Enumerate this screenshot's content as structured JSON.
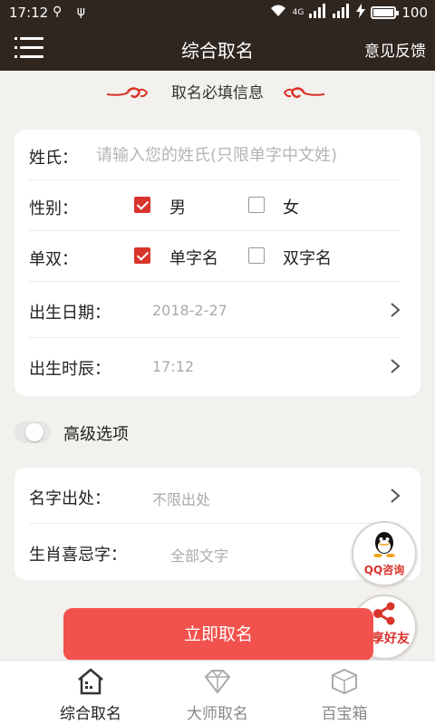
{
  "status_bar": {
    "time": "17:12",
    "battery": "100",
    "battery_level": 1.0,
    "network": "4G"
  },
  "navbar": {
    "title": "综合取名",
    "feedback": "意见反馈"
  },
  "section_title": "取名必填信息",
  "form": {
    "surname": {
      "label": "姓氏：",
      "placeholder": "请输入您的姓氏(只限单字中文姓)"
    },
    "gender": {
      "label": "性别：",
      "options": [
        {
          "label": "男",
          "checked": true
        },
        {
          "label": "女",
          "checked": false
        }
      ]
    },
    "single_double": {
      "label": "单双：",
      "options": [
        {
          "label": "单字名",
          "checked": true
        },
        {
          "label": "双字名",
          "checked": false
        }
      ]
    },
    "birth_date": {
      "label": "出生日期：",
      "value": "2018-2-27"
    },
    "birth_time": {
      "label": "出生时辰：",
      "value": "17:12"
    }
  },
  "advanced": {
    "label": "高级选项",
    "enabled": false
  },
  "advanced_form": {
    "name_source": {
      "label": "名字出处：",
      "value": "不限出处"
    },
    "zodiac_chars": {
      "label": "生肖喜忌字：",
      "value": "全部文字"
    }
  },
  "submit_label": "立即取名",
  "float_buttons": {
    "qq": "QQ咨询",
    "share": "分享好友"
  },
  "tabs": [
    {
      "label": "综合取名",
      "active": true
    },
    {
      "label": "大师取名",
      "active": false
    },
    {
      "label": "百宝箱",
      "active": false
    }
  ],
  "colors": {
    "header_bg": "#2f2620",
    "accent_red": "#d9342b",
    "button_red": "#f2524d",
    "page_bg": "#f2f1ed"
  }
}
